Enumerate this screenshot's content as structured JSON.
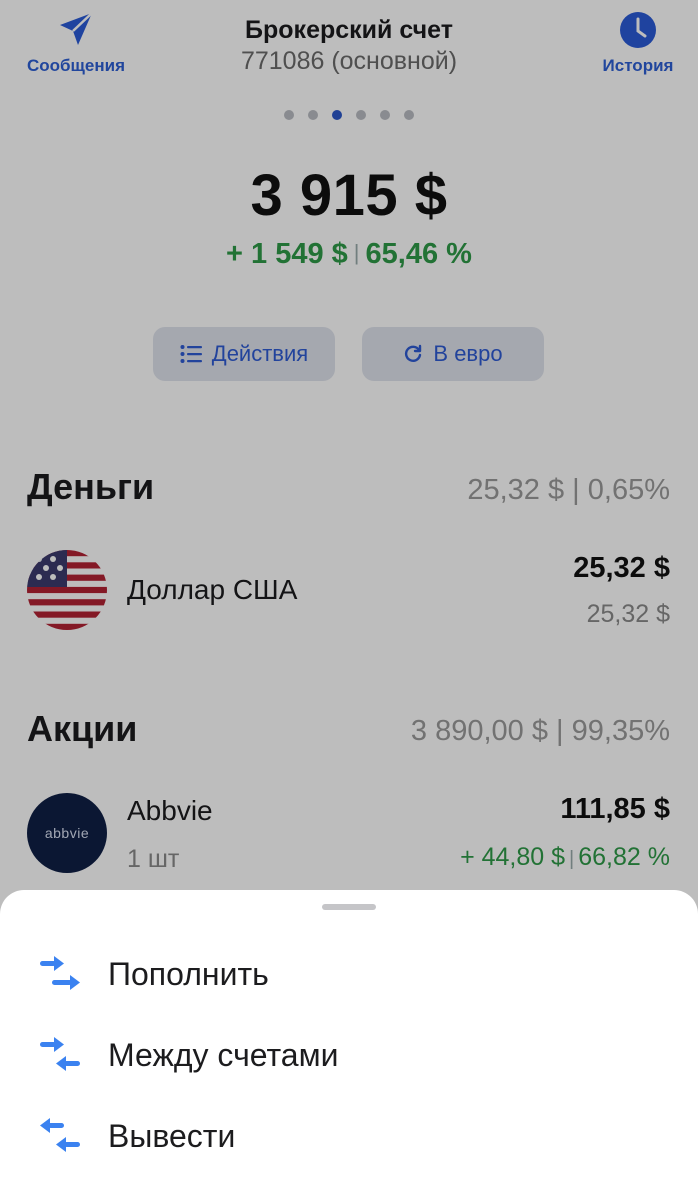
{
  "header": {
    "messages_label": "Сообщения",
    "history_label": "История",
    "account_title": "Брокерский счет",
    "account_subtitle": "771086 (основной)"
  },
  "pager": {
    "total": 6,
    "active_index": 2
  },
  "summary": {
    "balance": "3 915 $",
    "change_abs": "+ 1 549 $",
    "change_pct": "65,46 %"
  },
  "buttons": {
    "actions_label": "Действия",
    "currency_label": "В евро"
  },
  "money": {
    "title": "Деньги",
    "total": "25,32 $ | 0,65%",
    "items": [
      {
        "name": "Доллар США",
        "value": "25,32 $",
        "value2": "25,32 $"
      }
    ]
  },
  "stocks": {
    "title": "Акции",
    "total": "3 890,00 $ | 99,35%",
    "items": [
      {
        "name": "Abbvie",
        "qty": "1 шт",
        "value": "111,85 $",
        "gain_abs": "+ 44,80 $",
        "gain_pct": "66,82 %",
        "logo_text": "abbvie"
      }
    ]
  },
  "sheet": {
    "items": [
      {
        "label": "Пополнить",
        "icon": "transfer-in-icon"
      },
      {
        "label": "Между счетами",
        "icon": "transfer-between-icon"
      },
      {
        "label": "Вывести",
        "icon": "transfer-out-icon"
      }
    ]
  },
  "colors": {
    "accent": "#2d5fd4",
    "gain": "#2f9a48",
    "icon_blue": "#3b82f0"
  }
}
